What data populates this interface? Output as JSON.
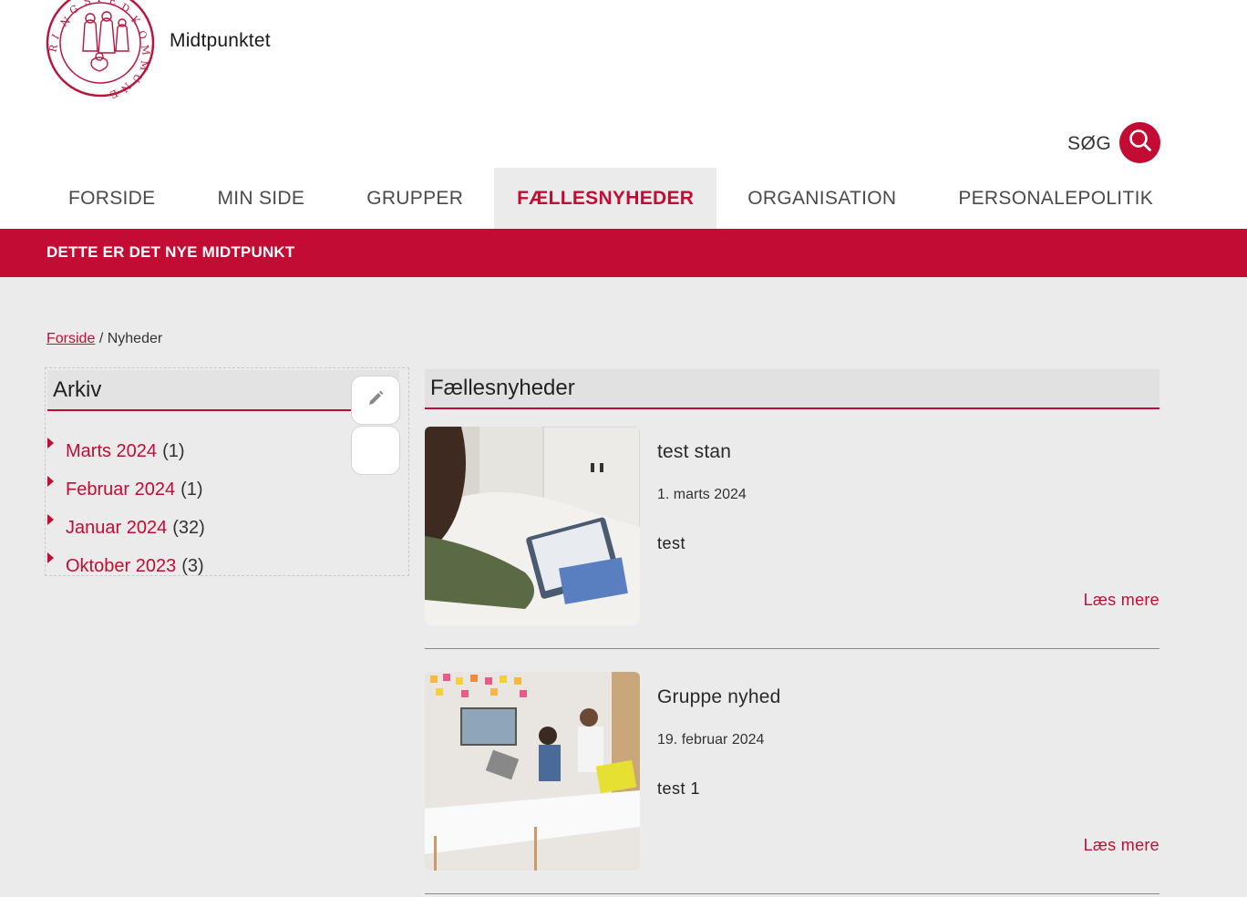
{
  "site": {
    "name": "Midtpunktet",
    "logo_text": "RINGSTED KOMMUNE"
  },
  "search": {
    "label": "SØG"
  },
  "nav": {
    "items": [
      {
        "label": "FORSIDE"
      },
      {
        "label": "MIN SIDE"
      },
      {
        "label": "GRUPPER"
      },
      {
        "label": "FÆLLESNYHEDER"
      },
      {
        "label": "ORGANISATION"
      },
      {
        "label": "PERSONALEPOLITIK"
      }
    ],
    "active": "FÆLLESNYHEDER"
  },
  "banner": {
    "text": "DETTE ER DET NYE MIDTPUNKT"
  },
  "breadcrumb": {
    "home": "Forside",
    "separator": "/",
    "current": "Nyheder"
  },
  "archive": {
    "title": "Arkiv",
    "items": [
      {
        "month": "Marts 2024",
        "count": "(1)"
      },
      {
        "month": "Februar 2024",
        "count": "(1)"
      },
      {
        "month": "Januar 2024",
        "count": "(32)"
      },
      {
        "month": "Oktober 2023",
        "count": "(3)"
      }
    ]
  },
  "news": {
    "title": "Fællesnyheder",
    "items": [
      {
        "title": "test stan",
        "date": "1. marts 2024",
        "excerpt": "test",
        "more": "Læs mere"
      },
      {
        "title": "Gruppe nyhed",
        "date": "19. februar 2024",
        "excerpt": "test 1",
        "more": "Læs mere"
      }
    ]
  },
  "colors": {
    "accent": "#c30c33",
    "background": "#ebebeb",
    "header": "#ffffff"
  },
  "icons": {
    "search": "search-icon",
    "edit": "pencil-icon",
    "archive_bullet": "triangle-right-icon"
  }
}
